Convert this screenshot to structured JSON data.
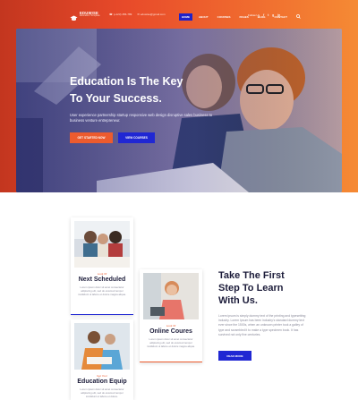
{
  "colors": {
    "primary_orange": "#ec5b2e",
    "primary_blue": "#2027d3",
    "dark_text": "#1c1c3a",
    "muted_text": "#8a8a9a"
  },
  "logo": {
    "name": "EDUWISE",
    "tagline": "Education Template"
  },
  "contact": [
    {
      "icon": "phone-icon",
      "text": "(+123) 456-789"
    },
    {
      "icon": "mail-icon",
      "text": "eduwise@gmail.com"
    }
  ],
  "nav": [
    {
      "label": "HOME",
      "active": true
    },
    {
      "label": "ABOUT"
    },
    {
      "label": "COURSES"
    },
    {
      "label": "PAGES"
    },
    {
      "label": "BLOG"
    },
    {
      "label": "CONTACT"
    }
  ],
  "search_icon": "search-icon",
  "follow": {
    "label": "Follow Us",
    "icons": [
      "facebook-icon",
      "twitter-icon",
      "google-plus-icon",
      "linkedin-icon"
    ]
  },
  "hero": {
    "title": "Education Is The Key\nTo Your Success.",
    "description": "User experience partnership startup responsive web design disruptive sales business to business venture entrepreneur.",
    "primary_button": "GET STARTED NOW",
    "secondary_button": "VIEW COURSES"
  },
  "cards": [
    {
      "kicker": "Look Of",
      "title": "Next Scheduled",
      "description": "Lorem ipsum dolor sit amet consectetur adipiscing elit, sed do eiusmod tempor incididunt ut labore et dolore magna aliqua."
    },
    {
      "kicker": "Look Of",
      "title": "Online Coures",
      "description": "Lorem ipsum dolor sit amet consectetur adipiscing elit, sed do eiusmod tempor incididunt ut labore et dolore magna aliqua."
    },
    {
      "kicker": "Get Your",
      "title": "Education Equip",
      "description": "Lorem ipsum dolor sit amet consectetur adipiscing elit, sed do eiusmod tempor incididunt ut labore et dolore."
    }
  ],
  "side": {
    "title": "Take The First\nStep To Learn\nWith Us.",
    "description": "Lorem ipsum is simply dummy text of the printing and typesetting industry. Lorem Ipsum has been industry's standard dummy text ever since the 1500s, when an unknown printer took a galley of type and scrambled it to make a type specimen book. It has survived not only five centuries.",
    "button": "READ MORE"
  }
}
